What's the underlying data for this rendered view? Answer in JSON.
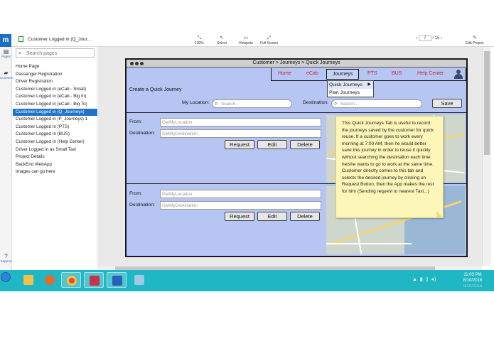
{
  "app": {
    "document_title": "Customer Logged in (Q_Jour...",
    "toolbar": {
      "zoom": "100%",
      "select": "Select",
      "hotspots": "Hotspots",
      "fullscreen": "Full Screen",
      "edit_project": "Edit Project"
    },
    "pager": {
      "current": "7",
      "total": "/ 15"
    },
    "rail": {
      "pages": "Pages",
      "comments": "Comments",
      "support": "Support"
    },
    "search_placeholder": "Search pages",
    "pages": [
      "Home Page",
      "Passenger Registration",
      "Driver Registration",
      "Customer Logged in (eCab - Small)",
      "Customer Logged in (eCab - Big In)",
      "Customer Logged in (eCab - Big To)",
      "Customer Logged in (Q_Journeys)",
      "Customer Logged in (P_Journeys) 1",
      "Customer Logged In (PTS)",
      "Customer Logged In (BUS)",
      "Customer Logged In (Help Center)",
      "Driver Logged in as Small Taxi",
      "Project Details",
      "BackEnd WebApp",
      "Images can go here"
    ],
    "active_page_index": 6
  },
  "mockup": {
    "breadcrumb": "Customer > Journeys > Quick Journeys",
    "nav": [
      "Home",
      "eCab",
      "Journeys",
      "PTS",
      "BUS",
      "Help Center"
    ],
    "selected_nav": "Journeys",
    "dropdown": [
      "Quick Journeys",
      "Plan Journeys"
    ],
    "create_title": "Create a Quick Journey",
    "my_location_label": "My Location:",
    "destination_label": "Destination:",
    "search_placeholder": "Search...",
    "save": "Save",
    "journeys": [
      {
        "from_label": "From:",
        "dest_label": "Destination:",
        "from_value": "GetMyLocation",
        "dest_value": "GetMyDestination",
        "request": "Request",
        "edit": "Edit",
        "delete": "Delete"
      },
      {
        "from_label": "From:",
        "dest_label": "Destination:",
        "from_value": "GetMyLocation",
        "dest_value": "GetMyDestination",
        "request": "Request",
        "edit": "Edit",
        "delete": "Delete"
      }
    ],
    "note": "This Quick Journeys Tab is useful to record the journeys saved by the customer for quick reuse. If a customer goes to work every morning at 7:00 AM, then he would better save this journey in order to reuse it quickly without searching the destination each time he/she wants to go to work at the same time. Customer directly comes to this tab and selects the desired journey by clicking on Request Button, then the App makes the rest for him (Sending request to nearest Taxi...)"
  },
  "taskbar": {
    "time": "11:03 PM",
    "date": "8/10/2016",
    "date_faint": "8/10/2016"
  },
  "colors": {
    "mockup_bg": "#b6c5f2",
    "active_page": "#1f73c9",
    "nav_link": "#c0282d",
    "note_bg": "#fcf6b8",
    "taskbar": "#1fb7c4"
  }
}
